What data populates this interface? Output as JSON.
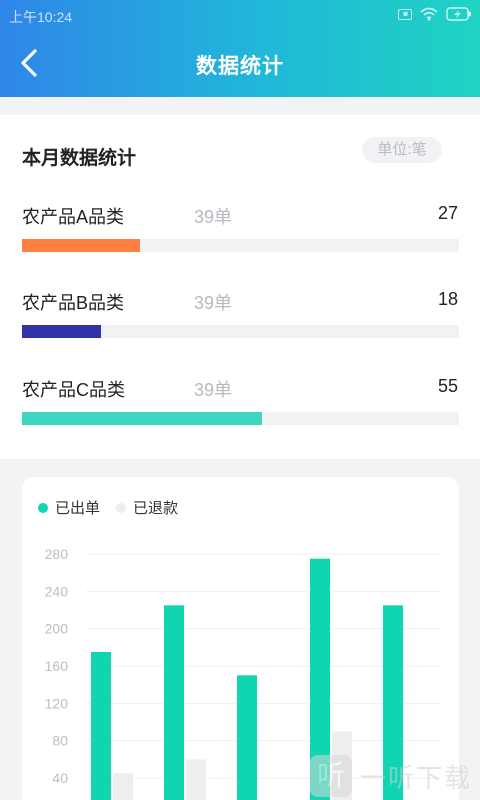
{
  "status": {
    "time": "上午10:24"
  },
  "header": {
    "title": "数据统计",
    "back_icon": "chevron-left-icon"
  },
  "summary": {
    "title": "本月数据统计",
    "unit": "单位:笔",
    "items": [
      {
        "label": "农产品A品类",
        "orders": "39单",
        "value": "27",
        "progress": 0.27,
        "color": "#ff7f3f"
      },
      {
        "label": "农产品B品类",
        "orders": "39单",
        "value": "18",
        "progress": 0.18,
        "color": "#3333a8"
      },
      {
        "label": "农产品C品类",
        "orders": "39单",
        "value": "55",
        "progress": 0.55,
        "color": "#3fd6c0"
      }
    ]
  },
  "legend": [
    {
      "label": "已出单",
      "color": "#0fd6b0"
    },
    {
      "label": "已退款",
      "color": "#eeeeee"
    }
  ],
  "chart_data": {
    "type": "bar",
    "categories": [
      "",
      "",
      "",
      "",
      ""
    ],
    "series": [
      {
        "name": "已出单",
        "values": [
          175,
          225,
          150,
          275,
          225
        ],
        "color": "#0fd6b0"
      },
      {
        "name": "已退款",
        "values": [
          45,
          60,
          null,
          90,
          null
        ],
        "color": "#eeeeee"
      }
    ],
    "yticks": [
      "280",
      "240",
      "200",
      "160",
      "120",
      "80",
      "40"
    ],
    "ylim": [
      0,
      280
    ],
    "grid": true,
    "legend_position": "top-left"
  },
  "watermark": {
    "text": "一听下载",
    "logo_char": "听"
  }
}
